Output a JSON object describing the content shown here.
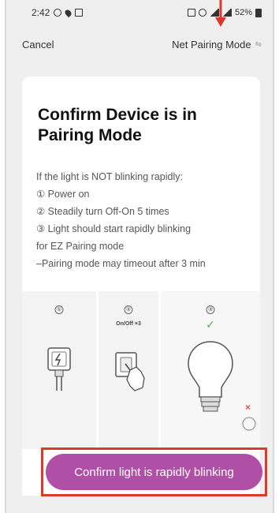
{
  "status_bar": {
    "time": "2:42",
    "battery": "52%"
  },
  "nav": {
    "cancel_label": "Cancel",
    "mode_label": "Net Pairing Mode",
    "switch_icon": "⇋"
  },
  "card": {
    "title": "Confirm Device is in Pairing Mode",
    "instructions": [
      "If the light is NOT blinking rapidly:",
      "① Power on",
      "② Steadily turn Off-On 5 times",
      "③ Light should start rapidly blinking",
      "for EZ Pairing mode",
      "–Pairing mode may timeout after 3 min"
    ]
  },
  "illustration": {
    "steps": [
      "①",
      "②",
      "③"
    ],
    "switch_label": "On/Off ×3"
  },
  "confirm_button": {
    "label": "Confirm light is rapidly blinking"
  },
  "colors": {
    "accent": "#b04fa6",
    "highlight": "#d93a2b",
    "check": "#4caf50"
  }
}
